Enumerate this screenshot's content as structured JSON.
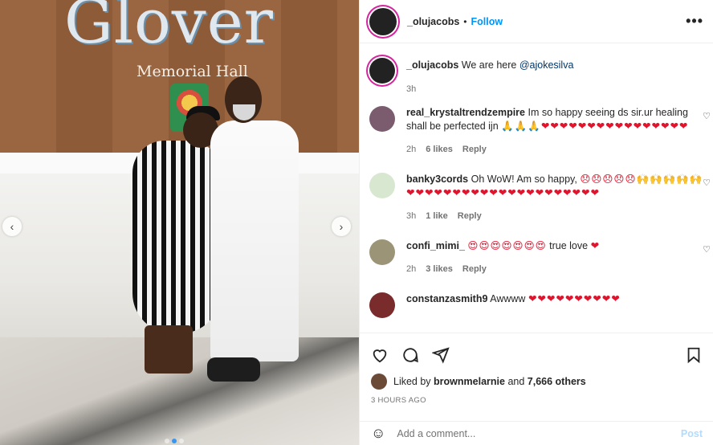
{
  "post": {
    "author": "_olujacobs",
    "separator": "•",
    "follow_label": "Follow",
    "more_label": "•••"
  },
  "photo": {
    "wall_title": "Glover",
    "wall_subtitle": "Memorial Hall",
    "nav_prev": "‹",
    "nav_next": "›",
    "slides": 3,
    "active_slide": 1
  },
  "caption": {
    "user": "_olujacobs",
    "text": "We are here",
    "mention": "@ajokesilva",
    "time": "3h"
  },
  "comments": [
    {
      "user": "real_krystaltrendzempire",
      "text": "Im so happy seeing ds sir.ur healing shall be perfected ijn",
      "emojis": "🙏🙏🙏❤❤❤❤❤❤❤❤❤❤❤❤❤❤❤❤",
      "time": "2h",
      "likes": "6 likes",
      "reply": "Reply",
      "avatar_color": "#7a5c6e"
    },
    {
      "user": "banky3cords",
      "text": "Oh WoW! Am so happy,",
      "emojis": "😞😞😞😞😞🙌🙌🙌🙌🙌❤❤❤❤❤❤❤❤❤❤❤❤❤❤❤❤❤❤❤❤❤",
      "time": "3h",
      "likes": "1 like",
      "reply": "Reply",
      "avatar_color": "#d8e8d0"
    },
    {
      "user": "confi_mimi_",
      "text_after": "true love",
      "emojis": "😍😍😍😍😍😍😍",
      "emoji_end": "❤",
      "time": "2h",
      "likes": "3 likes",
      "reply": "Reply",
      "avatar_color": "#9b9476"
    },
    {
      "user": "constanzasmith9",
      "text": "Awwww",
      "emojis": "❤❤❤❤❤❤❤❤❤❤",
      "avatar_color": "#7a2b2b"
    }
  ],
  "likes": {
    "prefix": "Liked by",
    "user": "brownmelarnie",
    "middle": "and",
    "others": "7,666 others"
  },
  "time_ago": "3 HOURS AGO",
  "add_comment": {
    "placeholder": "Add a comment...",
    "post_label": "Post",
    "emoji_icon": "☺"
  },
  "colors": {
    "accent": "#0095f6",
    "heart": "#e0142d",
    "muted": "#737373"
  }
}
